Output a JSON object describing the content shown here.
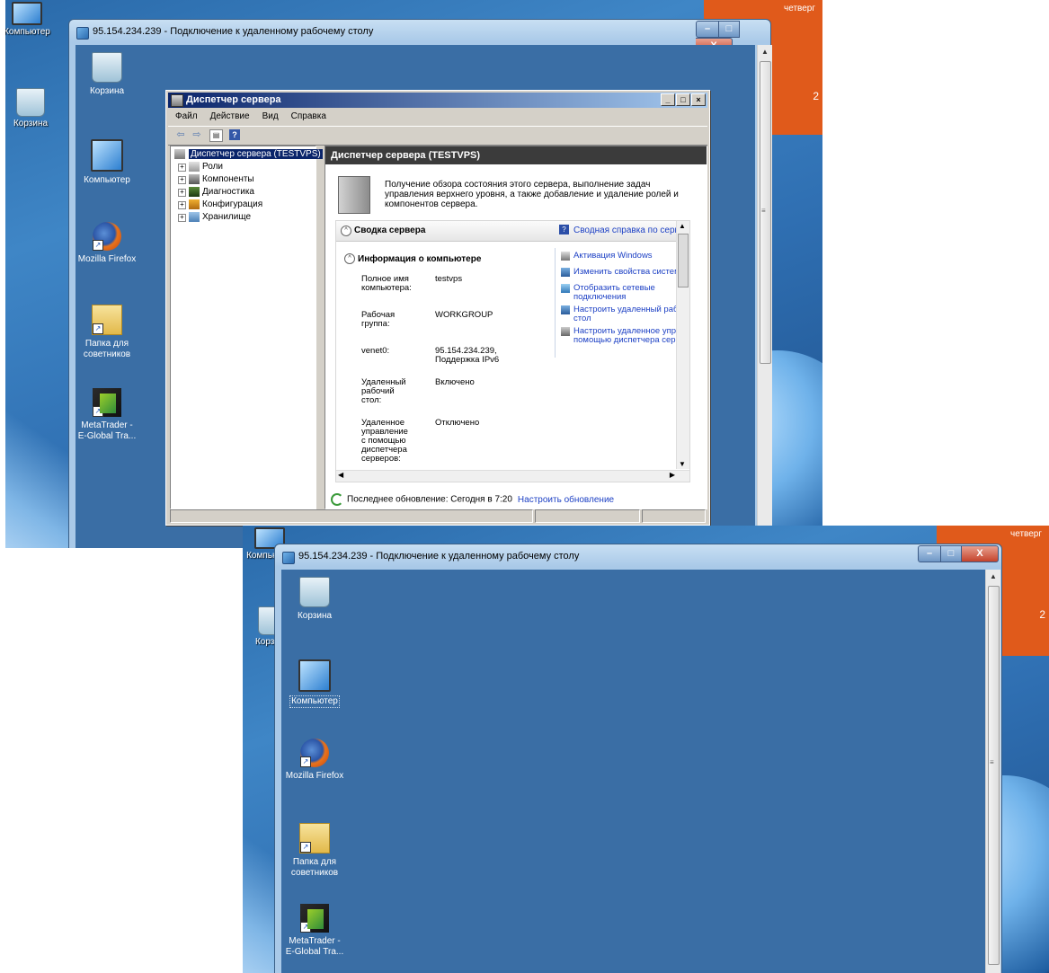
{
  "host": {
    "desktop_icons": [
      {
        "label": "Компьютер",
        "icon": "computer-icon"
      },
      {
        "label": "Корзина",
        "icon": "recycle-bin-icon"
      }
    ],
    "day": "четверг",
    "day_number": "2"
  },
  "rdp": {
    "title": "95.154.234.239 - Подключение к удаленному рабочему столу",
    "min_label": "–",
    "max_label": "□",
    "close_label": "X"
  },
  "remote_desktop_icons": [
    {
      "label": "Корзина",
      "icon": "recycle-bin-icon"
    },
    {
      "label": "Компьютер",
      "icon": "computer-icon"
    },
    {
      "label": "Mozilla Firefox",
      "icon": "firefox-icon"
    },
    {
      "label": "Папка для советников",
      "icon": "folder-icon"
    },
    {
      "label": "MetaTrader - E-Global Tra...",
      "icon": "metatrader-icon"
    }
  ],
  "server_manager": {
    "title": "Диспетчер сервера",
    "menu": [
      "Файл",
      "Действие",
      "Вид",
      "Справка"
    ],
    "tree": {
      "root": "Диспетчер сервера (TESTVPS)",
      "children": [
        "Роли",
        "Компоненты",
        "Диагностика",
        "Конфигурация",
        "Хранилище"
      ]
    },
    "pane_title": "Диспетчер сервера (TESTVPS)",
    "intro": "Получение обзора состояния этого сервера, выполнение задач управления верхнего уровня, а также добавление и удаление ролей и компонентов сервера.",
    "summary_title": "Сводка сервера",
    "summary_help": "Сводная справка по сервер",
    "computer_info_title": "Информация о компьютере",
    "info": [
      {
        "key": "Полное имя компьютера:",
        "value": "testvps"
      },
      {
        "key": "Рабочая группа:",
        "value": "WORKGROUP"
      },
      {
        "key": "venet0:",
        "value": "95.154.234.239, Поддержка IPv6"
      },
      {
        "key": "Удаленный рабочий стол:",
        "value": "Включено"
      },
      {
        "key": "Удаленное управление с помощью диспетчера серверов:",
        "value": "Отключено"
      }
    ],
    "actions": [
      "Активация Windows",
      "Изменить свойства системы",
      "Отобразить сетевые подключения",
      "Настроить удаленный рабо стол",
      "Настроить удаленное управ с помощью диспетчера серв"
    ],
    "last_update": "Последнее обновление: Сегодня в 7:20",
    "configure_update": "Настроить обновление"
  },
  "colors": {
    "remote_desktop_bg": "#3a6ea5",
    "title_bar_dark": "#0a246a",
    "link": "#1b3fc4",
    "orange_tile": "#e05a1b"
  }
}
